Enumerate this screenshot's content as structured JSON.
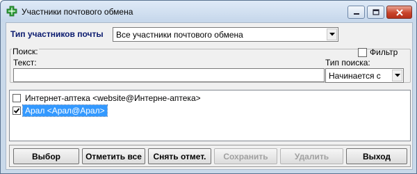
{
  "window": {
    "title": "Участники почтового обмена",
    "icon": "green-cross-icon"
  },
  "participants_type": {
    "label": "Тип участников почты",
    "selected": "Все участники почтового обмена"
  },
  "search": {
    "legend": "Поиск:",
    "filter_label": "Фильтр",
    "filter_checked": false,
    "text_label": "Текст:",
    "text_value": "",
    "type_label": "Тип поиска:",
    "type_selected": "Начинается с"
  },
  "list": {
    "items": [
      {
        "label": "Интернет-аптека <website@Интерне-аптека>",
        "checked": false,
        "selected": false
      },
      {
        "label": "Арал <Арал@Арал>",
        "checked": true,
        "selected": true
      }
    ]
  },
  "buttons": {
    "select": "Выбор",
    "check_all": "Отметить все",
    "uncheck": "Снять отмет.",
    "save": "Сохранить",
    "delete": "Удалить",
    "exit": "Выход"
  },
  "colors": {
    "selection": "#3399ff",
    "label_blue": "#0a1a6e"
  }
}
